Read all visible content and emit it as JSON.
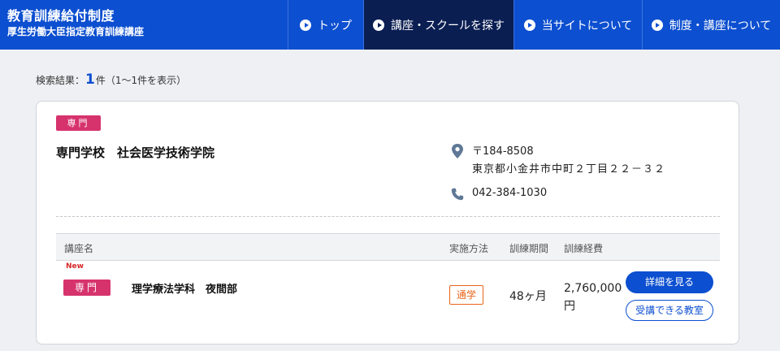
{
  "header": {
    "title": "教育訓練給付制度",
    "subtitle": "厚生労働大臣指定教育訓練講座",
    "nav": [
      {
        "label": "トップ"
      },
      {
        "label": "講座・スクールを探す"
      },
      {
        "label": "当サイトについて"
      },
      {
        "label": "制度・講座について"
      }
    ]
  },
  "results": {
    "prefix": "検索結果：",
    "count": "1",
    "suffix": "件（1～1件を表示）"
  },
  "school": {
    "badge": "専門",
    "name": "専門学校　社会医学技術学院",
    "postal": "〒184-8508",
    "address": "東京都小金井市中町２丁目２２－３２",
    "phone": "042-384-1030"
  },
  "table": {
    "headers": {
      "course": "講座名",
      "method": "実施方法",
      "period": "訓練期間",
      "cost": "訓練経費"
    },
    "rows": [
      {
        "new": "New",
        "badge": "専門",
        "name": "理学療法学科　夜間部",
        "method": "通学",
        "period": "48ヶ月",
        "cost": "2,760,000円",
        "detail_label": "詳細を見る",
        "class_label": "受講できる教室"
      }
    ]
  },
  "colors": {
    "header_bg": "#0c4fd0",
    "nav_active_bg": "#0a1e52",
    "badge_pink": "#d6336c",
    "method_orange": "#e8651a"
  }
}
